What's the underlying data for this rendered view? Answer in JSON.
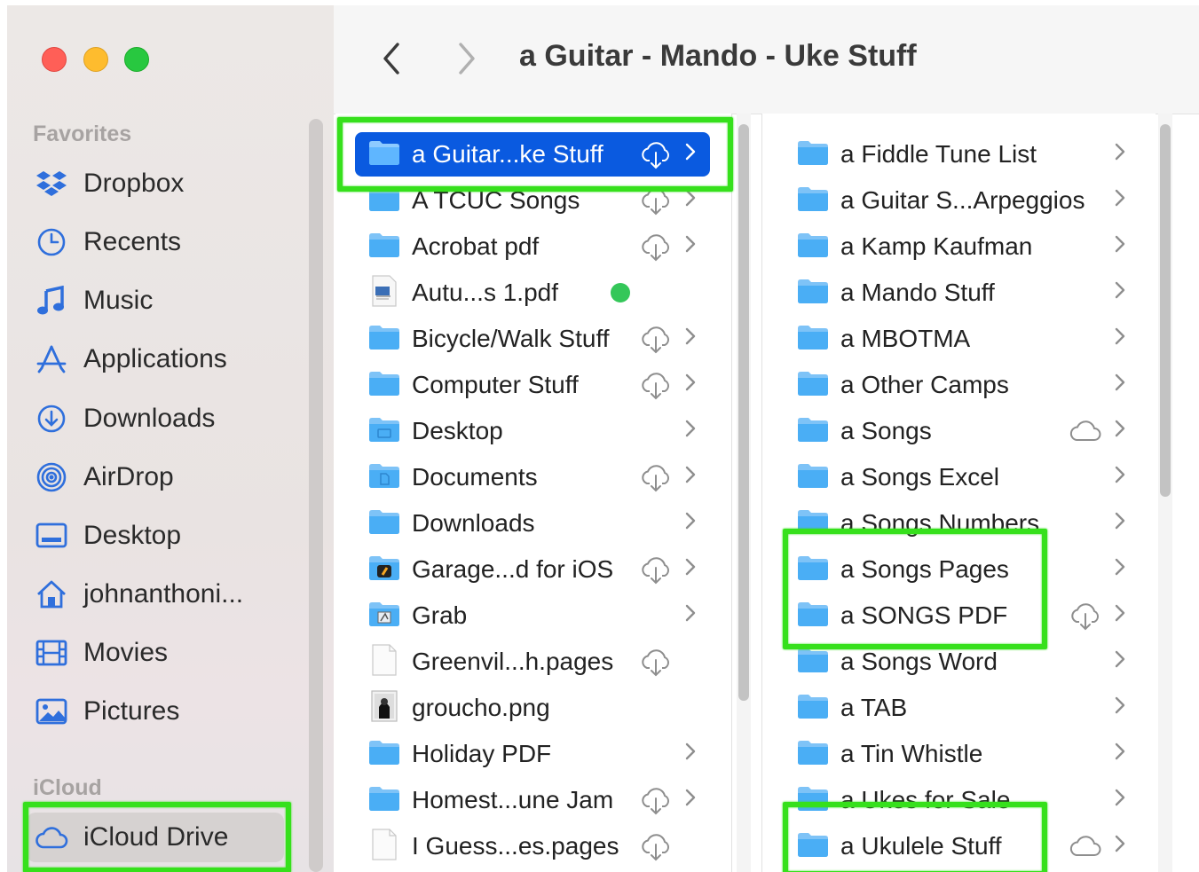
{
  "window": {
    "title": "a Guitar - Mando - Uke Stuff"
  },
  "sidebar": {
    "favorites_header": "Favorites",
    "icloud_header": "iCloud",
    "items": [
      {
        "label": "Dropbox",
        "icon": "dropbox-icon"
      },
      {
        "label": "Recents",
        "icon": "clock-icon"
      },
      {
        "label": "Music",
        "icon": "music-note-icon"
      },
      {
        "label": "Applications",
        "icon": "applications-icon"
      },
      {
        "label": "Downloads",
        "icon": "download-icon"
      },
      {
        "label": "AirDrop",
        "icon": "airdrop-icon"
      },
      {
        "label": "Desktop",
        "icon": "desktop-icon"
      },
      {
        "label": "johnanthoni...",
        "icon": "home-icon"
      },
      {
        "label": "Movies",
        "icon": "film-icon"
      },
      {
        "label": "Pictures",
        "icon": "photo-icon"
      }
    ],
    "icloud_drive": {
      "label": "iCloud Drive",
      "icon": "cloud-icon"
    }
  },
  "column1": {
    "rows": [
      {
        "name": "a Guitar...ke Stuff",
        "type": "folder",
        "cloud": true,
        "chevron": true,
        "selected": true
      },
      {
        "name": "A TCUC Songs",
        "type": "folder",
        "cloud": true,
        "chevron": true
      },
      {
        "name": "Acrobat pdf",
        "type": "folder",
        "cloud": true,
        "chevron": true
      },
      {
        "name": "Autu...s 1.pdf",
        "type": "pdf",
        "cloud": false,
        "chevron": false,
        "tag": "green"
      },
      {
        "name": "Bicycle/Walk Stuff",
        "type": "folder",
        "cloud": true,
        "chevron": true
      },
      {
        "name": "Computer Stuff",
        "type": "folder",
        "cloud": true,
        "chevron": true
      },
      {
        "name": "Desktop",
        "type": "desktop-folder",
        "cloud": false,
        "chevron": true
      },
      {
        "name": "Documents",
        "type": "documents-folder",
        "cloud": true,
        "chevron": true
      },
      {
        "name": "Downloads",
        "type": "folder",
        "cloud": false,
        "chevron": true
      },
      {
        "name": "Garage...d for iOS",
        "type": "garageband-folder",
        "cloud": true,
        "chevron": true
      },
      {
        "name": "Grab",
        "type": "grab-folder",
        "cloud": false,
        "chevron": true
      },
      {
        "name": "Greenvil...h.pages",
        "type": "document",
        "cloud": true,
        "chevron": false
      },
      {
        "name": "groucho.png",
        "type": "image",
        "cloud": false,
        "chevron": false
      },
      {
        "name": "Holiday PDF",
        "type": "folder",
        "cloud": false,
        "chevron": true
      },
      {
        "name": "Homest...une Jam",
        "type": "folder",
        "cloud": true,
        "chevron": true
      },
      {
        "name": "I Guess...es.pages",
        "type": "document",
        "cloud": true,
        "chevron": false
      }
    ]
  },
  "column2": {
    "rows": [
      {
        "name": "a Fiddle Tune List",
        "cloud": false
      },
      {
        "name": "a Guitar S...Arpeggios",
        "cloud": false
      },
      {
        "name": "a Kamp Kaufman",
        "cloud": false
      },
      {
        "name": "a Mando Stuff",
        "cloud": false
      },
      {
        "name": "a MBOTMA",
        "cloud": false
      },
      {
        "name": "a Other Camps",
        "cloud": false
      },
      {
        "name": "a Songs",
        "cloud": "plain"
      },
      {
        "name": "a Songs Excel",
        "cloud": false
      },
      {
        "name": "a Songs Numbers",
        "cloud": false
      },
      {
        "name": "a Songs Pages",
        "cloud": false
      },
      {
        "name": "a SONGS PDF",
        "cloud": "download"
      },
      {
        "name": "a Songs Word",
        "cloud": false
      },
      {
        "name": "a TAB",
        "cloud": false
      },
      {
        "name": "a Tin Whistle",
        "cloud": false
      },
      {
        "name": "a Ukes for Sale",
        "cloud": false
      },
      {
        "name": "a Ukulele Stuff",
        "cloud": "plain"
      }
    ]
  },
  "colors": {
    "accent": "#0a5ae0",
    "folder": "#4aaef5",
    "highlight": "#36e01c",
    "tag_green": "#34c759"
  }
}
